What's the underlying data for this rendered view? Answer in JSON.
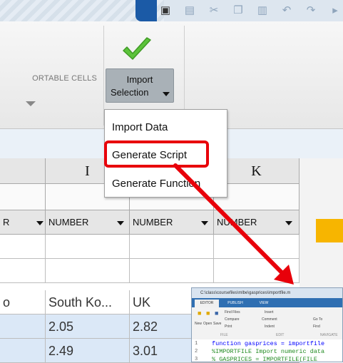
{
  "ribbon": {
    "section_label": "ORTABLE CELLS",
    "import_button": {
      "line1": "Import",
      "line2": "Selection"
    }
  },
  "menu": {
    "items": [
      "Import Data",
      "Generate Script",
      "Generate Function"
    ],
    "highlighted": "Generate Script"
  },
  "grid": {
    "columns": [
      "I",
      "K"
    ],
    "type_headers": [
      "R",
      "NUMBER",
      "NUMBER",
      "NUMBER"
    ],
    "rows": [
      [
        "o",
        "South Ko...",
        "UK"
      ],
      [
        "",
        "2.05",
        "2.82"
      ],
      [
        "",
        "2.49",
        "3.01"
      ]
    ]
  },
  "editor": {
    "title": "C:\\class\\coursefiles\\mlbe\\gasprices\\importfile.m",
    "tabs": [
      "EDITOR",
      "PUBLISH",
      "VIEW"
    ],
    "ribbon_labels": [
      "Find Files",
      "Compare",
      "Print",
      "New",
      "Open",
      "Save",
      "FILE",
      "Insert",
      "Comment",
      "Indent",
      "EDIT",
      "Go To",
      "Find",
      "NAVIGATE"
    ],
    "lines": [
      {
        "num": "1",
        "text": "function gasprices = importfile"
      },
      {
        "num": "2",
        "text": "%IMPORTFILE Import numeric data"
      },
      {
        "num": "3",
        "text": "%   GASPRICES = IMPORTFILE(FILE"
      }
    ]
  },
  "colors": {
    "highlight": "#e8000a",
    "check": "#5cc33b",
    "accent": "#f7b500",
    "selection": "#dbe8f7"
  }
}
